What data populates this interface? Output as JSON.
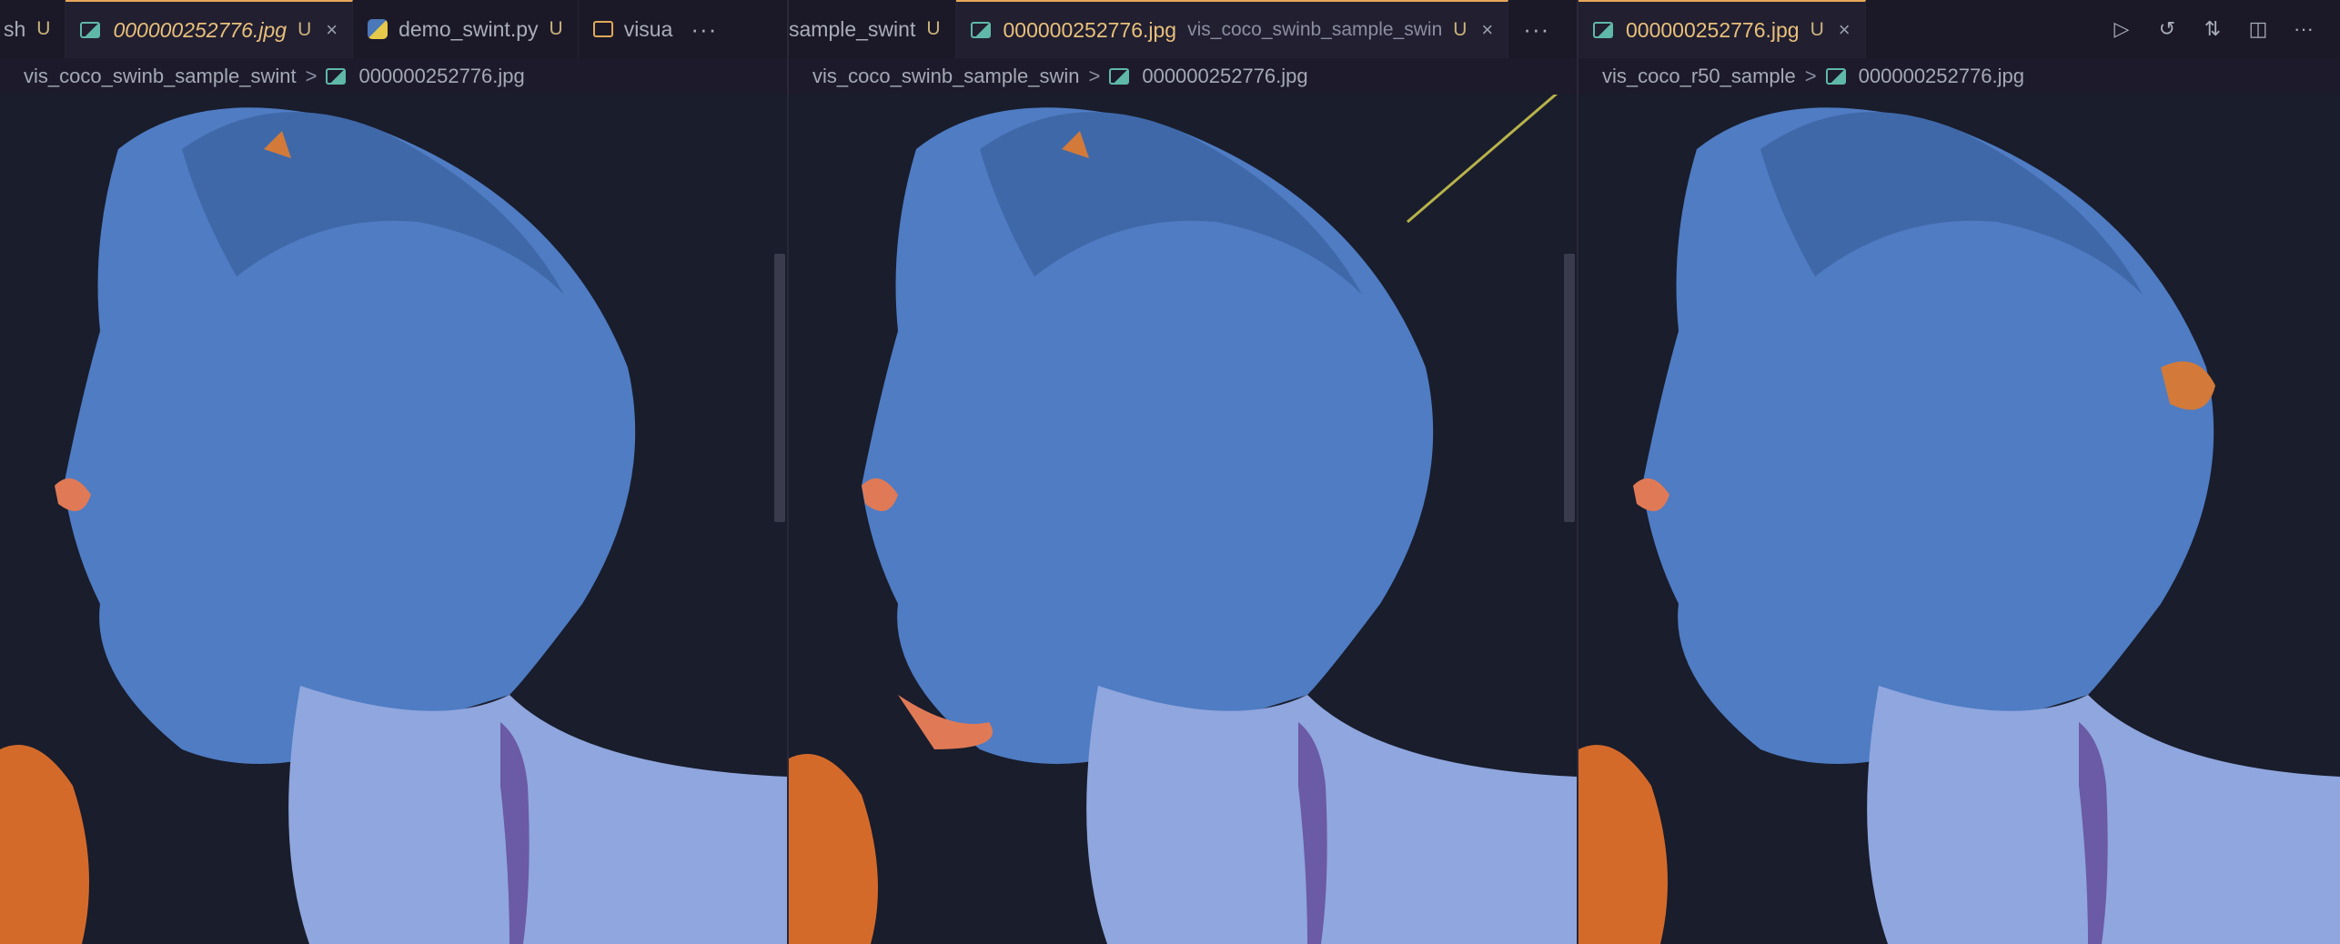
{
  "pane1": {
    "tabs": [
      {
        "name": "sh",
        "mod": "U"
      },
      {
        "name": "000000252776.jpg",
        "mod": "U",
        "close": "×"
      },
      {
        "name": "demo_swint.py",
        "mod": "U"
      },
      {
        "name": "visua"
      }
    ],
    "more": "···",
    "breadcrumb": {
      "folder": "vis_coco_swinb_sample_swint",
      "file": "000000252776.jpg"
    }
  },
  "pane2": {
    "tabs": [
      {
        "name": "sample_swint",
        "mod": "U"
      },
      {
        "name": "000000252776.jpg",
        "desc": "vis_coco_swinb_sample_swin",
        "mod": "U",
        "close": "×"
      }
    ],
    "more": "···",
    "breadcrumb": {
      "folder": "vis_coco_swinb_sample_swin",
      "file": "000000252776.jpg"
    }
  },
  "pane3": {
    "tabs": [
      {
        "name": "000000252776.jpg",
        "mod": "U",
        "close": "×"
      }
    ],
    "actions": [
      "run-icon",
      "history-icon",
      "compare-changes-icon",
      "split-editor-icon",
      "more-actions-icon"
    ],
    "more": "···",
    "breadcrumb": {
      "folder": "vis_coco_r50_sample",
      "file": "000000252776.jpg"
    }
  },
  "separator": ">",
  "colors": {
    "accent": "#e8a85a",
    "modified": "#c9b27a",
    "image_icon": "#5fb8a8",
    "mask_overlay": "#5a86d6"
  }
}
